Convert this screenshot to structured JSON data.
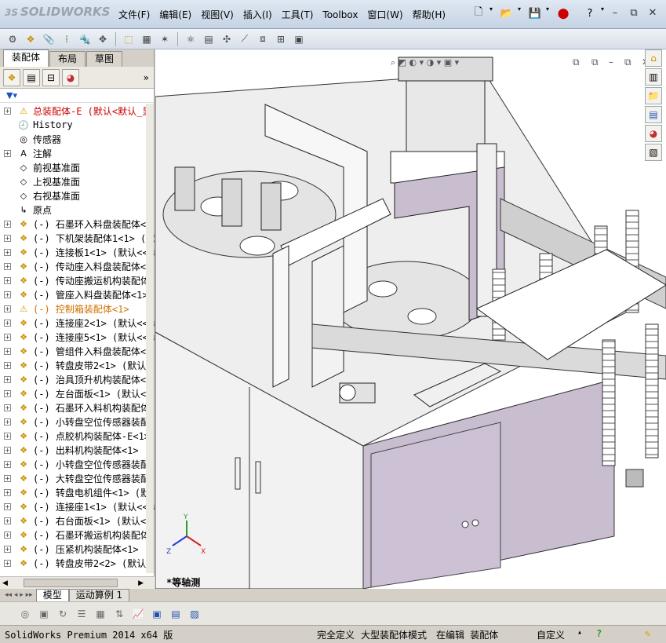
{
  "app": {
    "logo_mark": "3S",
    "logo_text": "SOLIDWORKS"
  },
  "menu": [
    "文件(F)",
    "编辑(E)",
    "视图(V)",
    "插入(I)",
    "工具(T)",
    "Toolbox",
    "窗口(W)",
    "帮助(H)"
  ],
  "left_tabs": [
    "装配体",
    "布局",
    "草图"
  ],
  "tree": [
    {
      "label": "总装配体-E  (默认<默认_显",
      "icon": "assembly-warning-icon",
      "kind": "top"
    },
    {
      "label": "History",
      "icon": "history-icon"
    },
    {
      "label": "传感器",
      "icon": "sensor-icon"
    },
    {
      "label": "注解",
      "icon": "annotation-icon"
    },
    {
      "label": "前视基准面",
      "icon": "plane-icon"
    },
    {
      "label": "上视基准面",
      "icon": "plane-icon"
    },
    {
      "label": "右视基准面",
      "icon": "plane-icon"
    },
    {
      "label": "原点",
      "icon": "origin-icon"
    },
    {
      "label": "(-) 石墨环入料盘装配体<",
      "icon": "subassembly-icon"
    },
    {
      "label": "(-) 下机架装配体1<1> (默",
      "icon": "subassembly-icon"
    },
    {
      "label": "(-) 连接板1<1> (默认<<默",
      "icon": "subassembly-icon"
    },
    {
      "label": "(-) 传动座入料盘装配体<",
      "icon": "subassembly-icon"
    },
    {
      "label": "(-) 传动座搬运机构装配体",
      "icon": "subassembly-icon"
    },
    {
      "label": "(-) 管座入料盘装配体<1>",
      "icon": "subassembly-icon"
    },
    {
      "label": "(-) 控制箱装配体<1>",
      "icon": "subassembly-warning-icon",
      "kind": "warn"
    },
    {
      "label": "(-) 连接座2<1> (默认<<默",
      "icon": "subassembly-icon"
    },
    {
      "label": "(-) 连接座5<1> (默认<<默",
      "icon": "subassembly-icon"
    },
    {
      "label": "(-) 管组件入料盘装配体<",
      "icon": "subassembly-icon"
    },
    {
      "label": "(-) 转盘皮带2<1> (默认<",
      "icon": "subassembly-icon"
    },
    {
      "label": "(-) 治具顶升机构装配体<",
      "icon": "subassembly-icon"
    },
    {
      "label": "(-) 左台面板<1> (默认<<",
      "icon": "subassembly-icon"
    },
    {
      "label": "(-) 石墨环入料机构装配体",
      "icon": "subassembly-icon"
    },
    {
      "label": "(-) 小转盘空位传感器装配",
      "icon": "subassembly-icon"
    },
    {
      "label": "(-) 点胶机构装配体-E<1>",
      "icon": "subassembly-icon"
    },
    {
      "label": "(-) 出料机构装配体<1> (",
      "icon": "subassembly-icon"
    },
    {
      "label": "(-) 小转盘空位传感器装配",
      "icon": "subassembly-icon"
    },
    {
      "label": "(-) 大转盘空位传感器装配",
      "icon": "subassembly-icon"
    },
    {
      "label": "(-) 转盘电机组件<1> (默",
      "icon": "subassembly-icon"
    },
    {
      "label": "(-) 连接座1<1> (默认<<默",
      "icon": "subassembly-icon"
    },
    {
      "label": "(-) 右台面板<1> (默认<<",
      "icon": "subassembly-icon"
    },
    {
      "label": "(-) 石墨环搬运机构装配体",
      "icon": "subassembly-icon"
    },
    {
      "label": "(-) 压紧机构装配体<1> (",
      "icon": "subassembly-icon"
    },
    {
      "label": "(-) 转盘皮带2<2> (默认<",
      "icon": "subassembly-icon"
    }
  ],
  "view_label": "*等轴测",
  "bottom_tabs": [
    "模型",
    "运动算例 1"
  ],
  "status": {
    "product": "SolidWorks Premium 2014 x64 版",
    "define": "完全定义",
    "mode": "大型装配体模式",
    "editing": "在编辑 装配体",
    "custom": "自定义"
  },
  "colors": {
    "accent": "#c00000",
    "panel": "#c9bdd0",
    "frame": "#8a8a8a"
  }
}
